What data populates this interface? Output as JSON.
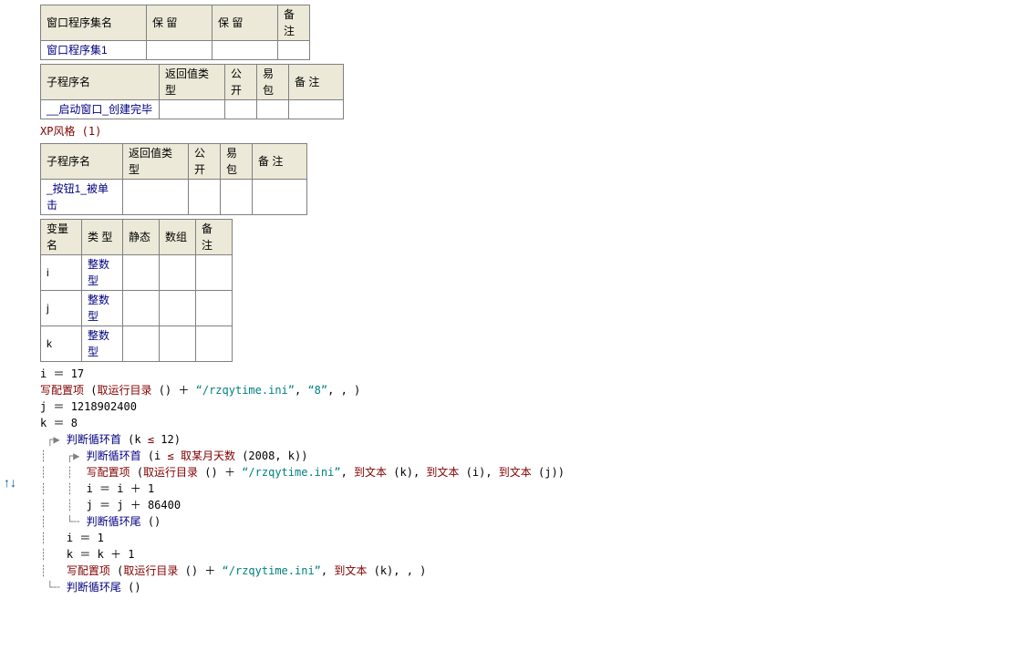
{
  "table1": {
    "headers": [
      "窗口程序集名",
      "保 留",
      "保 留",
      "备 注"
    ],
    "row": [
      "窗口程序集1",
      "",
      "",
      ""
    ]
  },
  "table2": {
    "headers": [
      "子程序名",
      "返回值类型",
      "公开",
      "易包",
      "备 注"
    ],
    "row": [
      "__启动窗口_创建完毕",
      "",
      "",
      "",
      ""
    ]
  },
  "note1": "XP风格 (1)",
  "table3": {
    "headers": [
      "子程序名",
      "返回值类型",
      "公开",
      "易包",
      "备 注"
    ],
    "row": [
      "_按钮1_被单击",
      "",
      "",
      "",
      ""
    ]
  },
  "table4": {
    "headers": [
      "变量名",
      "类 型",
      "静态",
      "数组",
      "备 注"
    ],
    "rows": [
      [
        "i",
        "整数型",
        "",
        "",
        ""
      ],
      [
        "j",
        "整数型",
        "",
        "",
        ""
      ],
      [
        "k",
        "整数型",
        "",
        "",
        ""
      ]
    ]
  },
  "code": {
    "l1": {
      "var": "i",
      "eq": " ＝ ",
      "val": "17"
    },
    "l2": {
      "fn": "写配置项",
      "paren_l": " (",
      "fn2": "取运行目录",
      "unit": " ()",
      "plus": " ＋ ",
      "str": "“/rzqytime.ini”",
      "comma": ", ",
      "str2": "“8”",
      "tail": ", , )"
    },
    "l3": {
      "var": "j",
      "eq": " ＝ ",
      "val": "1218902400"
    },
    "l4": {
      "var": "k",
      "eq": " ＝ ",
      "val": "8"
    },
    "l5": {
      "tree": " ┌▶ ",
      "kw": "判断循环首",
      "open": " (k ",
      "op": "≤",
      "val": " 12)"
    },
    "l6": {
      "tree": "┊   ┌▶ ",
      "kw": "判断循环首",
      "open": " (i ",
      "op": "≤",
      "fn": " 取某月天数",
      "args": " (2008, k))"
    },
    "l7": {
      "tree": "┊   ┊  ",
      "fn": "写配置项",
      "paren_l": " (",
      "fn2": "取运行目录",
      "unit": " ()",
      "plus": " ＋ ",
      "str": "“/rzqytime.ini”",
      "c": ", ",
      "fn3": "到文本",
      "a1": " (k)",
      "fn4": "到文本",
      "a2": " (i)",
      "fn5": "到文本",
      "a3": " (j))"
    },
    "l8": {
      "tree": "┊   ┊  ",
      "lhs": "i",
      "eq": " ＝ ",
      "rhs": "i ＋ 1"
    },
    "l9": {
      "tree": "┊   ┊  ",
      "lhs": "j",
      "eq": " ＝ ",
      "rhs": "j ＋ 86400"
    },
    "l10": {
      "tree": "┊   └╌ ",
      "kw": "判断循环尾",
      "paren": " ()"
    },
    "l11": {
      "tree": "┊   ",
      "lhs": "i",
      "eq": " ＝ ",
      "rhs": "1"
    },
    "l12": {
      "tree": "┊   ",
      "lhs": "k",
      "eq": " ＝ ",
      "rhs": "k ＋ 1"
    },
    "l13": {
      "tree": "┊   ",
      "fn": "写配置项",
      "paren_l": " (",
      "fn2": "取运行目录",
      "unit": " ()",
      "plus": " ＋ ",
      "str": "“/rzqytime.ini”",
      "c": ", ",
      "fn3": "到文本",
      "a1": " (k)",
      "tail": ", , )"
    },
    "l14": {
      "tree": " └╌ ",
      "kw": "判断循环尾",
      "paren": " ()"
    }
  },
  "gutter": "↑↓"
}
